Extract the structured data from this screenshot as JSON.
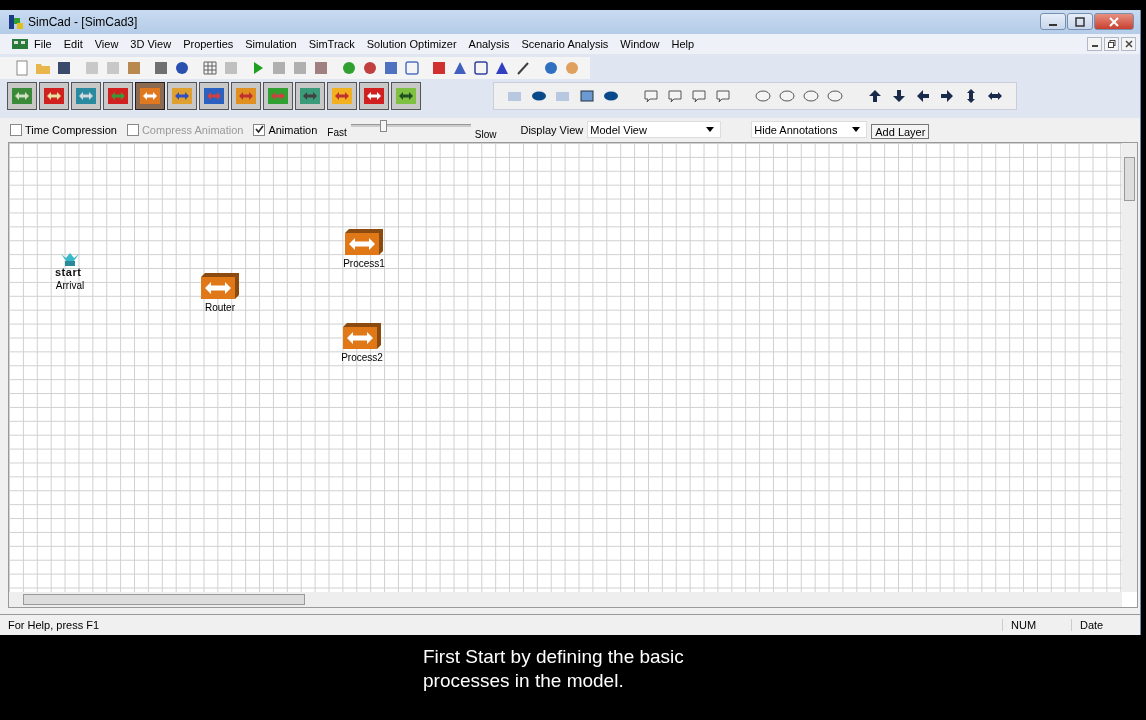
{
  "window": {
    "title": "SimCad - [SimCad3]"
  },
  "menu": [
    "File",
    "Edit",
    "View",
    "3D View",
    "Properties",
    "Simulation",
    "SimTrack",
    "Solution Optimizer",
    "Analysis",
    "Scenario Analysis",
    "Window",
    "Help"
  ],
  "options": {
    "checkboxes": [
      {
        "label": "Time Compression",
        "checked": false,
        "disabled": false
      },
      {
        "label": "Compress Animation",
        "checked": false,
        "disabled": true
      },
      {
        "label": "Animation",
        "checked": true,
        "disabled": false
      }
    ],
    "speed": {
      "fast_label": "Fast",
      "slow_label": "Slow",
      "level": 0.27
    },
    "display_view": {
      "label": "Display View",
      "value": "Model View"
    },
    "annotations": {
      "value": "Hide Annotations"
    },
    "add_layer": "Add Layer"
  },
  "canvas": {
    "nodes": [
      {
        "kind": "start",
        "label": "Arrival",
        "icon_text": "start"
      },
      {
        "kind": "process",
        "label": "Router"
      },
      {
        "kind": "process",
        "label": "Process1"
      },
      {
        "kind": "process",
        "label": "Process2"
      }
    ]
  },
  "status_bar": {
    "message": "For Help, press F1",
    "panes": [
      "NUM",
      "Date"
    ]
  },
  "caption": [
    "First Start by defining the basic",
    "processes in the model."
  ]
}
